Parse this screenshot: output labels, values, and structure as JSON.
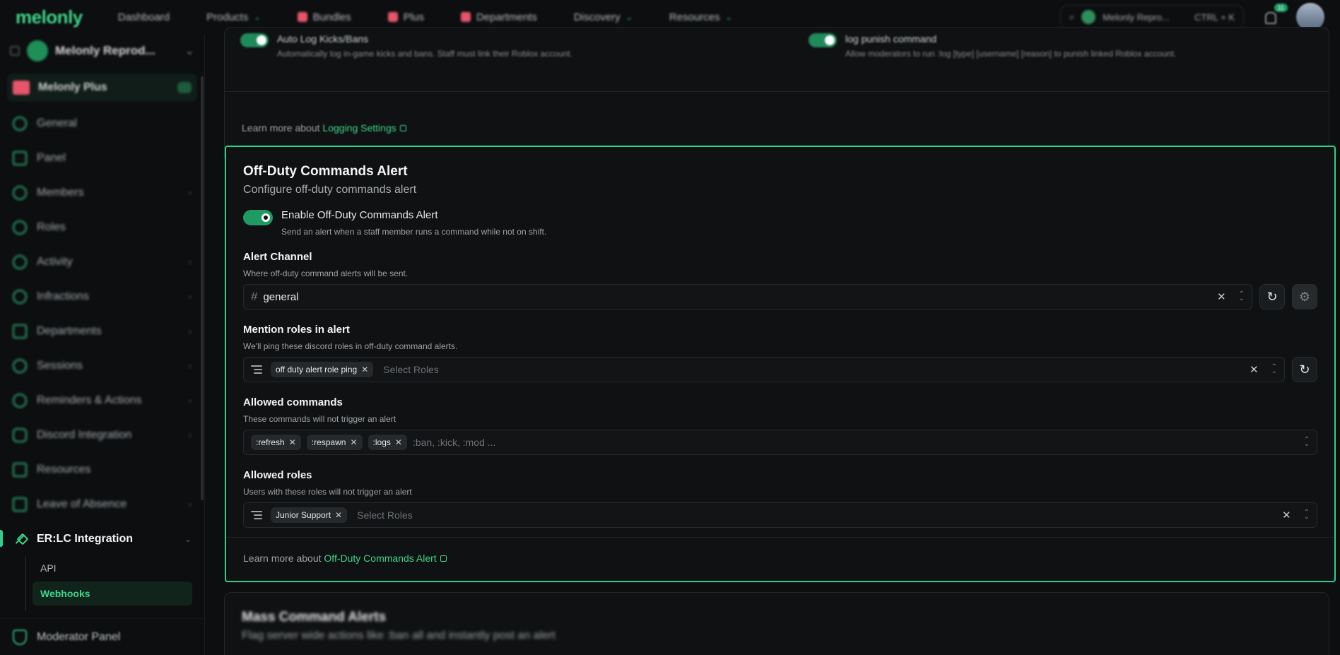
{
  "topnav": {
    "logo": "melonly",
    "items": [
      {
        "label": "Dashboard",
        "chevron": false
      },
      {
        "label": "Products",
        "chevron": true
      },
      {
        "label": "Bundles",
        "chevron": false
      },
      {
        "label": "Plus",
        "chevron": false
      },
      {
        "label": "Departments",
        "chevron": false
      },
      {
        "label": "Discovery",
        "chevron": true
      },
      {
        "label": "Resources",
        "chevron": true
      }
    ],
    "search_server": "Melonly Repro...",
    "search_shortcut": "CTRL + K",
    "notif_count": "11"
  },
  "sidebar": {
    "server_name": "Melonly Reprod...",
    "plus_label": "Melonly Plus",
    "items": [
      {
        "label": "General",
        "chevron": false
      },
      {
        "label": "Panel",
        "chevron": false
      },
      {
        "label": "Members",
        "chevron": true
      },
      {
        "label": "Roles",
        "chevron": false
      },
      {
        "label": "Activity",
        "chevron": true
      },
      {
        "label": "Infractions",
        "chevron": true
      },
      {
        "label": "Departments",
        "chevron": true
      },
      {
        "label": "Sessions",
        "chevron": true
      },
      {
        "label": "Reminders & Actions",
        "chevron": true
      },
      {
        "label": "Discord Integration",
        "chevron": true
      },
      {
        "label": "Resources",
        "chevron": false
      },
      {
        "label": "Leave of Absence",
        "chevron": true
      }
    ],
    "active_group": "ER:LC Integration",
    "sub_items": [
      {
        "label": "API",
        "active": false
      },
      {
        "label": "Webhooks",
        "active": true
      }
    ],
    "bottom_label": "Moderator Panel"
  },
  "prev_card": {
    "left_title": "Auto Log Kicks/Bans",
    "left_desc": "Automatically log in-game kicks and bans. Staff must link their Roblox account.",
    "right_title": "log punish command",
    "right_desc": "Allow moderators to run :log [type] [username] [reason] to punish linked Roblox account.",
    "learn_prefix": "Learn more about",
    "learn_link": "Logging Settings"
  },
  "card": {
    "title": "Off-Duty Commands Alert",
    "subtitle": "Configure off-duty commands alert",
    "enable": {
      "title": "Enable Off-Duty Commands Alert",
      "desc": "Send an alert when a staff member runs a command while not on shift.",
      "on": true
    },
    "alert_channel": {
      "label": "Alert Channel",
      "desc": "Where off-duty command alerts will be sent.",
      "value": "general"
    },
    "mention_roles": {
      "label": "Mention roles in alert",
      "desc": "We'll ping these discord roles in off-duty command alerts.",
      "chips": [
        "off duty alert role ping"
      ],
      "placeholder": "Select Roles"
    },
    "allowed_commands": {
      "label": "Allowed commands",
      "desc": "These commands will not trigger an alert",
      "chips": [
        ":refresh",
        ":respawn",
        ":logs"
      ],
      "placeholder": ":ban, :kick, :mod ..."
    },
    "allowed_roles": {
      "label": "Allowed roles",
      "desc": "Users with these roles will not trigger an alert",
      "chips": [
        "Junior Support"
      ],
      "placeholder": "Select Roles"
    },
    "learn_prefix": "Learn more about",
    "learn_link": "Off-Duty Commands Alert"
  },
  "next_card": {
    "title": "Mass Command Alerts",
    "subtitle": "Flag server wide actions like :ban all and instantly post an alert"
  },
  "colors": {
    "accent": "#2fd08a",
    "background": "#0c0e0f",
    "card": "#0f1112"
  }
}
